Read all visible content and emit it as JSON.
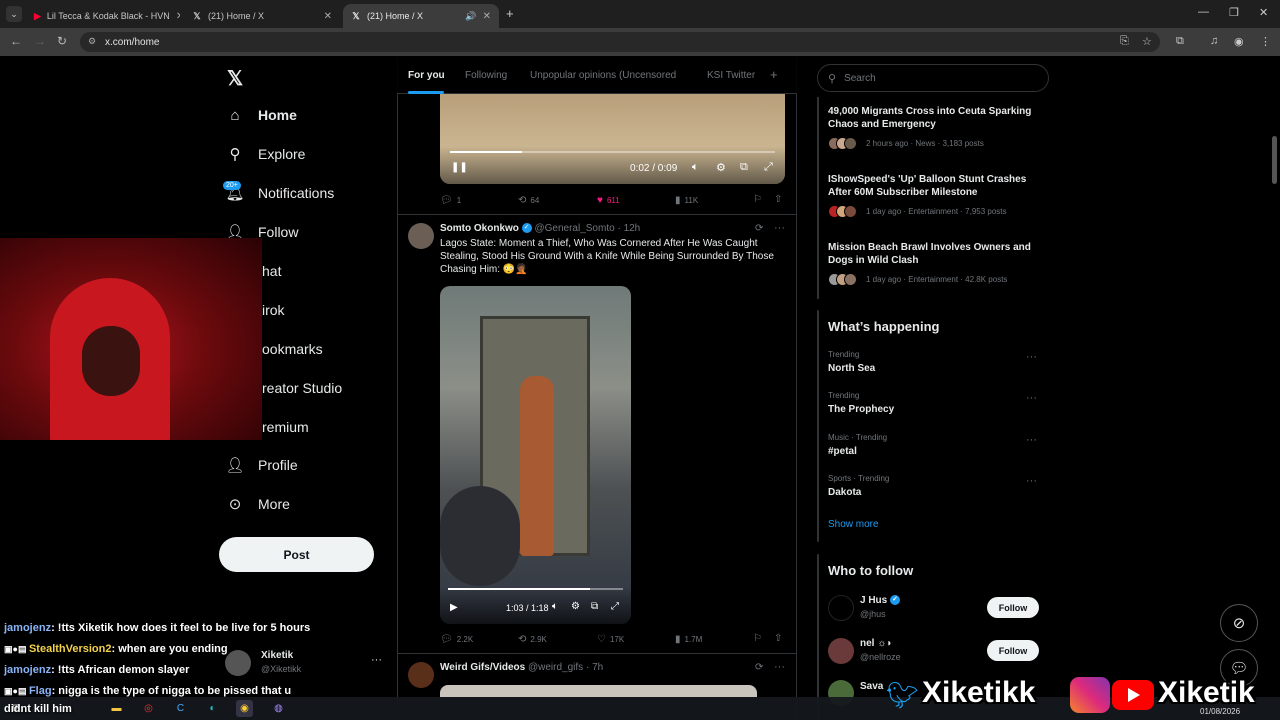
{
  "browser": {
    "tabs": [
      {
        "label": "Lil Tecca & Kodak Black - HVN",
        "favicon": "youtube-icon"
      },
      {
        "label": "(21) Home / X",
        "favicon": "x-logo-icon"
      },
      {
        "label": "(21) Home / X",
        "favicon": "x-logo-icon"
      }
    ],
    "url": "x.com/home"
  },
  "x_nav": {
    "items": [
      {
        "label": "Home",
        "icon": "home-icon"
      },
      {
        "label": "Explore",
        "icon": "search-icon"
      },
      {
        "label": "Notifications",
        "icon": "bell-icon",
        "badge": "20+"
      },
      {
        "label": "Follow",
        "icon": "person-plus-icon"
      },
      {
        "label": "Chat",
        "visible": "hat"
      },
      {
        "label": "Grok",
        "visible": "irok"
      },
      {
        "label": "Bookmarks",
        "visible": "ookmarks"
      },
      {
        "label": "Creator Studio",
        "visible": "reator Studio"
      },
      {
        "label": "Premium",
        "visible": "remium"
      },
      {
        "label": "Profile",
        "icon": "person-icon"
      },
      {
        "label": "More",
        "icon": "more-circle-icon"
      }
    ],
    "post_button": "Post",
    "account": {
      "name": "Xiketik",
      "handle": "@Xiketikk"
    }
  },
  "feed": {
    "tabs": [
      "For you",
      "Following",
      "Unpopular opinions (Uncensored",
      "KSI Twitter"
    ],
    "tweet1": {
      "video_time": "0:02 / 0:09",
      "replies": "1",
      "reposts": "64",
      "likes": "611",
      "views": "11K"
    },
    "tweet2": {
      "name": "Somto Okonkwo",
      "handle": "@General_Somto",
      "time": "12h",
      "text": "Lagos State: Moment a Thief, Who Was Cornered After He Was Caught Stealing, Stood His Ground With a Knife While Being Surrounded By Those Chasing Him: 😳🤦🏾",
      "video_time": "1:03 / 1:18",
      "replies": "2.2K",
      "reposts": "2.9K",
      "likes": "17K",
      "views": "1.7M"
    },
    "tweet3": {
      "name": "Weird Gifs/Videos",
      "handle": "@weird_gifs",
      "time": "7h"
    }
  },
  "sidebar_right": {
    "search_placeholder": "Search",
    "news": [
      {
        "title": "49,000 Migrants Cross into Ceuta Sparking Chaos and Emergency",
        "meta": "2 hours ago · News · 3,183 posts"
      },
      {
        "title": "IShowSpeed's 'Up' Balloon Stunt Crashes After 60M Subscriber Milestone",
        "meta": "1 day ago · Entertainment · 7,953 posts"
      },
      {
        "title": "Mission Beach Brawl Involves Owners and Dogs in Wild Clash",
        "meta": "1 day ago · Entertainment · 42.8K posts"
      }
    ],
    "happening_title": "What’s happening",
    "trends": [
      {
        "category": "Trending",
        "name": "North Sea"
      },
      {
        "category": "Trending",
        "name": "The Prophecy"
      },
      {
        "category": "Music · Trending",
        "name": "#petal"
      },
      {
        "category": "Sports · Trending",
        "name": "Dakota"
      }
    ],
    "show_more": "Show more",
    "who_to_follow_title": "Who to follow",
    "follow_suggestions": [
      {
        "name": "J Hus",
        "handle": "@jhus",
        "button": "Follow"
      },
      {
        "name": "nel ☼◗",
        "handle": "@nellroze",
        "button": "Follow"
      },
      {
        "name": "Sava",
        "handle": "",
        "button": ""
      }
    ]
  },
  "stream_chat": [
    {
      "user": "jamojenz",
      "msg": ": !tts Xiketik how does it feel to be live for 5 hours"
    },
    {
      "user": "StealthVersion2",
      "msg": ": when are you ending"
    },
    {
      "user": "jamojenz",
      "msg": ": !tts African demon slayer"
    },
    {
      "user": "Flag",
      "msg": ": nigga is the type of nigga to be pissed that u"
    },
    {
      "user": "",
      "msg": "didnt kill him"
    }
  ],
  "stream_branding": {
    "twitter_handle": "Xiketikk",
    "youtube_handle": "Xiketik"
  },
  "taskbar": {
    "date": "01/08/2026"
  }
}
